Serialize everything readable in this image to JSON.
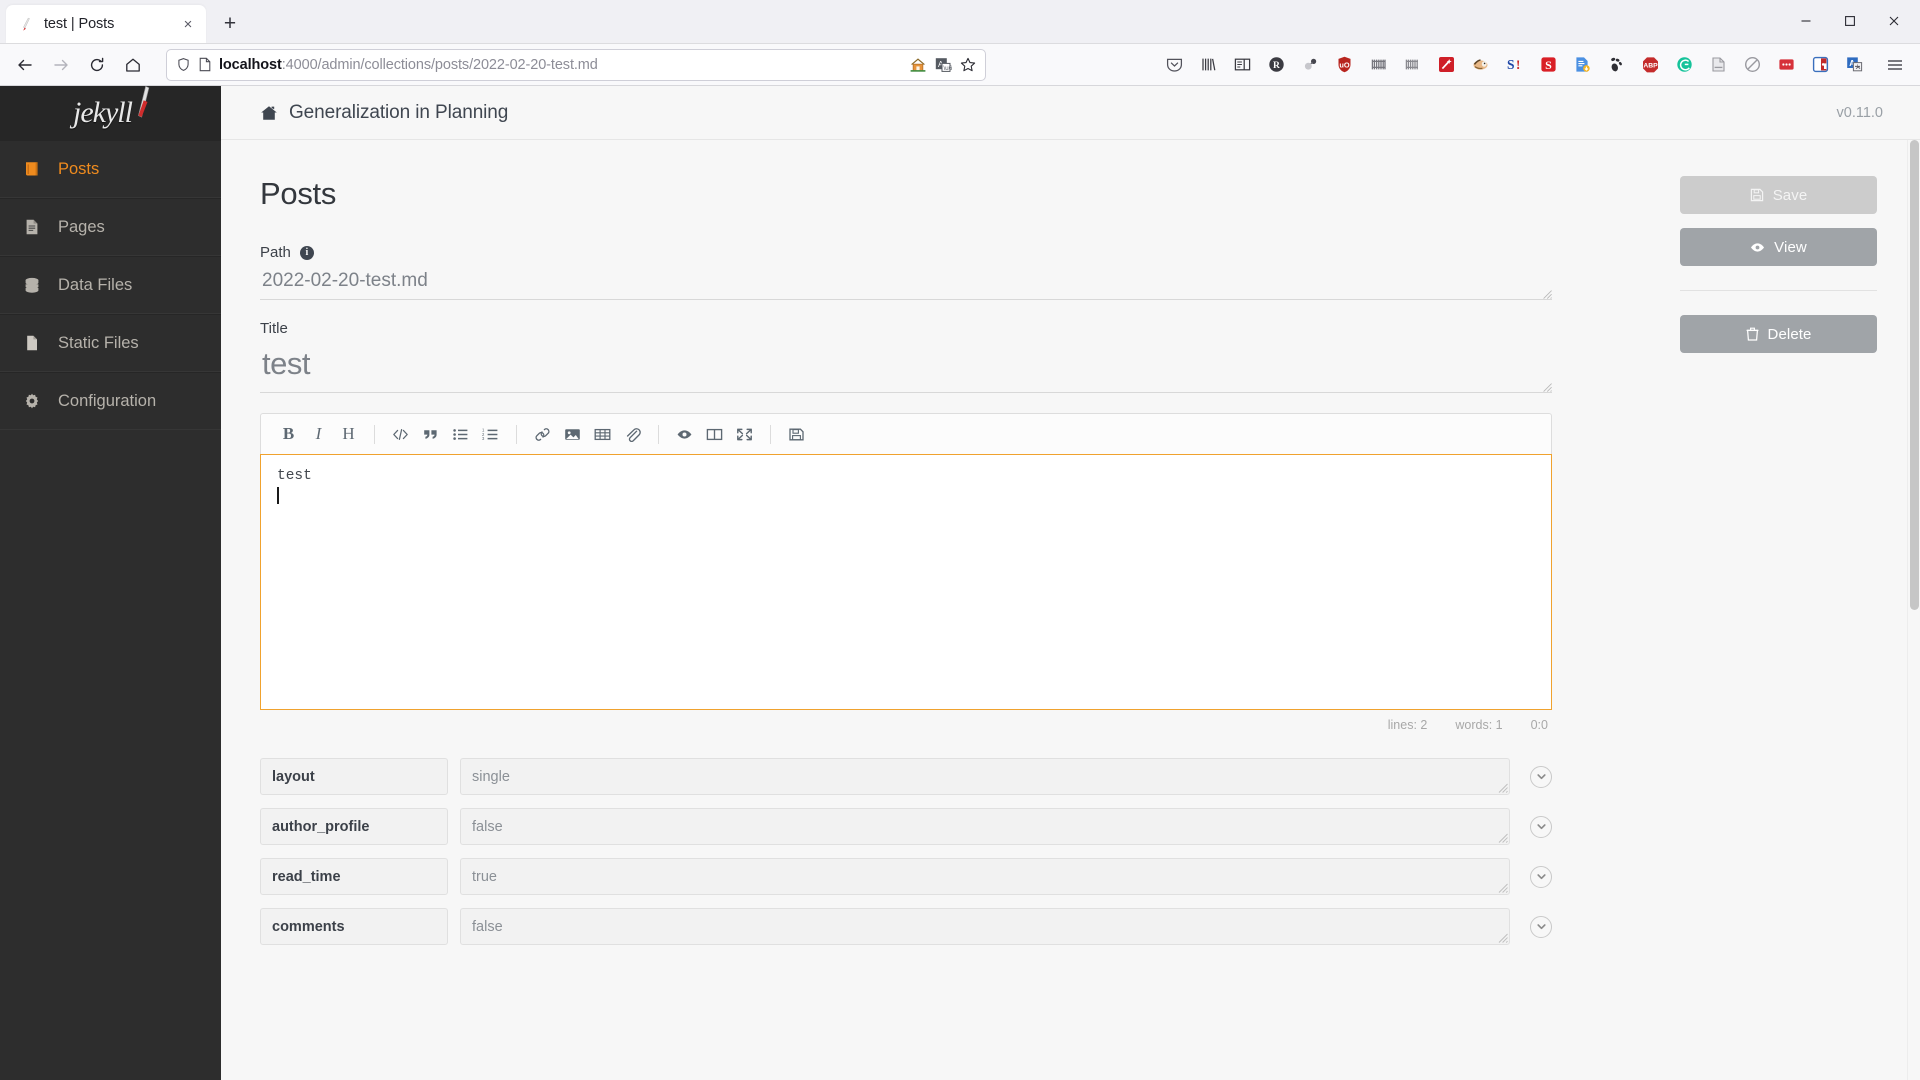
{
  "browser": {
    "tab": {
      "title": "test | Posts",
      "favicon": "jekyll-favicon-icon",
      "close": "×"
    },
    "newtab_label": "+",
    "window_controls": {
      "minimize": "—",
      "maximize": "❐",
      "close": "✕"
    },
    "nav": {
      "back": "back-arrow-icon",
      "forward": "forward-arrow-icon",
      "reload": "reload-icon",
      "home": "home-icon"
    },
    "url": {
      "host": "localhost",
      "path": ":4000/admin/collections/posts/2022-02-20-test.md",
      "full": "localhost:4000/admin/collections/posts/2022-02-20-test.md",
      "shield_icon": "tracking-protection-shield-icon",
      "page_icon": "page-document-icon",
      "reader_icon": "reader-home-icon",
      "translate_icon": "translate-icon",
      "bookmark_icon": "bookmark-star-icon"
    },
    "extensions": [
      "pocket-icon",
      "library-icon",
      "sidebar-icon",
      "researchgate-icon",
      "zotero-icon",
      "ublock-origin-icon",
      "barcode-icon",
      "pallet-icon",
      "magic-wand-icon",
      "badger-icon",
      "sci-hub-icon",
      "s-red-icon",
      "save-page-icon",
      "gnome-icon",
      "adblock-plus-icon",
      "grammarly-icon",
      "paper-icon",
      "noscript-icon",
      "cookie-icon",
      "privacy-badger-icon",
      "translate-ext-icon"
    ],
    "app_menu": "hamburger-menu-icon"
  },
  "sidebar": {
    "brand": "jekyll",
    "items": [
      {
        "label": "Posts",
        "icon": "book-icon",
        "active": true
      },
      {
        "label": "Pages",
        "icon": "file-lines-icon",
        "active": false
      },
      {
        "label": "Data Files",
        "icon": "database-icon",
        "active": false
      },
      {
        "label": "Static Files",
        "icon": "file-icon",
        "active": false
      },
      {
        "label": "Configuration",
        "icon": "gear-icon",
        "active": false
      }
    ]
  },
  "topbar": {
    "home_icon": "home-icon",
    "site_title": "Generalization in Planning",
    "version": "v0.11.0"
  },
  "page": {
    "heading": "Posts",
    "path": {
      "label": "Path",
      "info_glyph": "i",
      "value": "2022-02-20-test.md"
    },
    "title": {
      "label": "Title",
      "value": "test"
    }
  },
  "editor": {
    "toolbar": [
      {
        "name": "bold-button",
        "glyph": "B",
        "kind": "bold"
      },
      {
        "name": "italic-button",
        "glyph": "I",
        "kind": "ital"
      },
      {
        "name": "heading-button",
        "glyph": "H",
        "kind": "head"
      },
      {
        "name": "separator-1",
        "kind": "sep"
      },
      {
        "name": "code-button",
        "glyph": "</>",
        "kind": "svg-code"
      },
      {
        "name": "quote-button",
        "glyph": "“",
        "kind": "svg-quote"
      },
      {
        "name": "unordered-list-button",
        "kind": "svg-ul"
      },
      {
        "name": "ordered-list-button",
        "kind": "svg-ol"
      },
      {
        "name": "separator-2",
        "kind": "sep"
      },
      {
        "name": "link-button",
        "kind": "svg-link"
      },
      {
        "name": "image-button",
        "kind": "svg-image"
      },
      {
        "name": "table-button",
        "kind": "svg-table"
      },
      {
        "name": "attachment-button",
        "kind": "svg-clip"
      },
      {
        "name": "separator-3",
        "kind": "sep"
      },
      {
        "name": "preview-button",
        "kind": "svg-eye"
      },
      {
        "name": "side-by-side-button",
        "kind": "svg-columns"
      },
      {
        "name": "fullscreen-button",
        "kind": "svg-expand"
      },
      {
        "name": "separator-4",
        "kind": "sep"
      },
      {
        "name": "save-button",
        "kind": "svg-floppy"
      }
    ],
    "content": "test",
    "status": {
      "lines": "lines: 2",
      "words": "words: 1",
      "cursor": "0:0"
    },
    "focus_color": "#f0a22e"
  },
  "front_matter": {
    "rows": [
      {
        "key": "layout",
        "value": "single"
      },
      {
        "key": "author_profile",
        "value": "false"
      },
      {
        "key": "read_time",
        "value": "true"
      },
      {
        "key": "comments",
        "value": "false"
      }
    ],
    "chevron_icon": "chevron-down-icon"
  },
  "actions": {
    "save": {
      "label": "Save",
      "icon": "floppy-disk-icon",
      "disabled": true
    },
    "view": {
      "label": "View",
      "icon": "eye-icon",
      "disabled": false
    },
    "delete": {
      "label": "Delete",
      "icon": "trash-icon",
      "disabled": false
    }
  },
  "colors": {
    "sidebar_bg": "#2d2d2d",
    "active_orange": "#ef8b1e",
    "editor_focus": "#f0a22e",
    "button_gray": "#a0a4a8",
    "button_disabled": "#cccccc"
  }
}
